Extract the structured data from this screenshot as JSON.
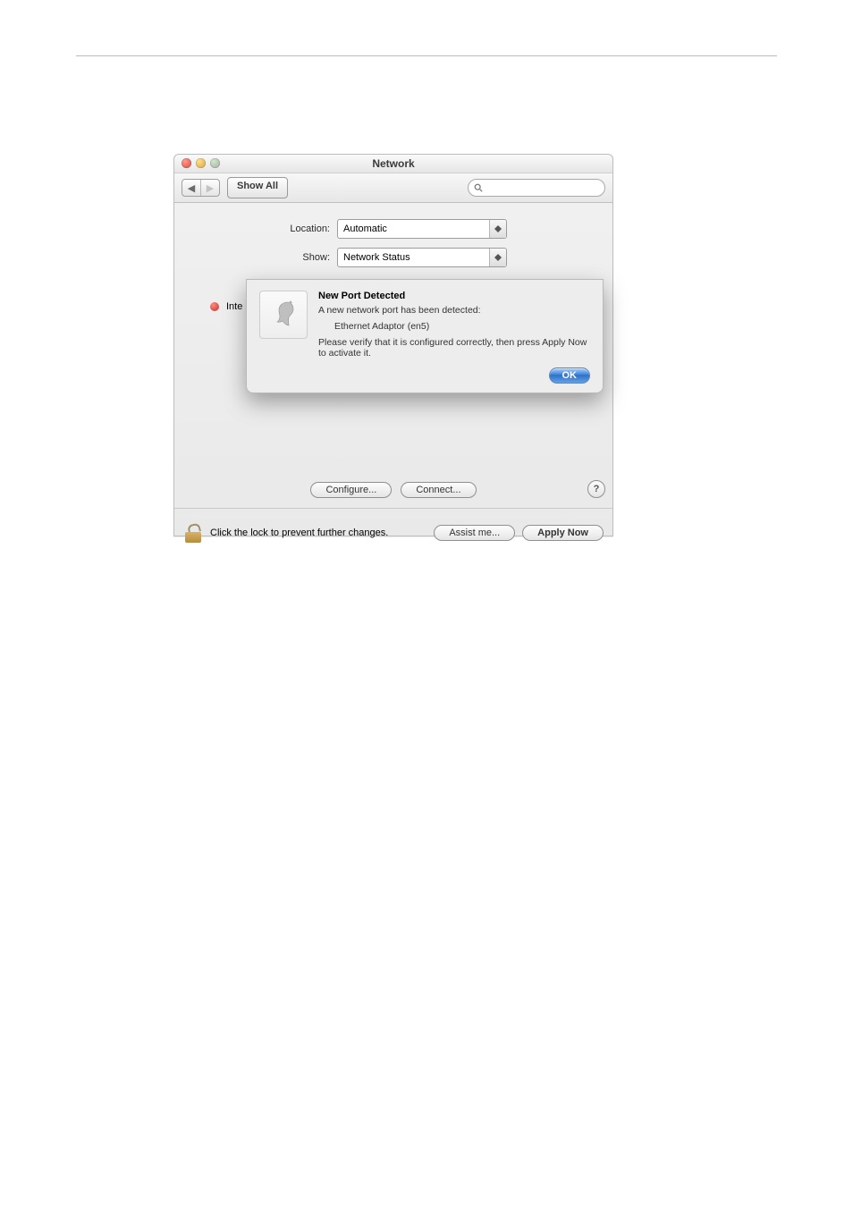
{
  "window": {
    "title": "Network",
    "toolbar": {
      "show_all": "Show All",
      "search_placeholder": ""
    }
  },
  "form": {
    "location_label": "Location:",
    "location_value": "Automatic",
    "show_label": "Show:",
    "show_value": "Network Status"
  },
  "status_list": {
    "items": [
      {
        "label_visible": "Inte",
        "state": "red"
      }
    ]
  },
  "sheet": {
    "title": "New Port Detected",
    "line1": "A new network port has been detected:",
    "port_name": "Ethernet Adaptor (en5)",
    "line2": "Please verify that it is configured correctly, then press Apply Now to activate it.",
    "ok": "OK"
  },
  "buttons": {
    "configure": "Configure...",
    "connect": "Connect...",
    "help": "?",
    "assist": "Assist me...",
    "apply_now": "Apply Now"
  },
  "footer": {
    "lock_text": "Click the lock to prevent further changes."
  }
}
